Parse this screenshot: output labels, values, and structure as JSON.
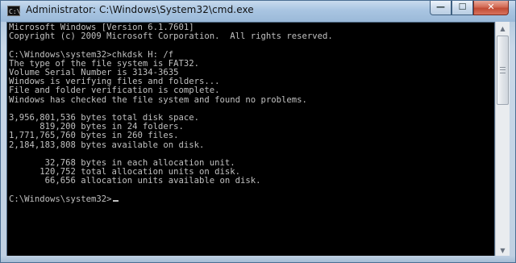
{
  "window": {
    "title": "Administrator: C:\\Windows\\System32\\cmd.exe",
    "icon_label": "C:\\",
    "controls": {
      "minimize": "—",
      "maximize": "☐",
      "close": "✕"
    }
  },
  "console": {
    "lines": [
      "Microsoft Windows [Version 6.1.7601]",
      "Copyright (c) 2009 Microsoft Corporation.  All rights reserved.",
      "",
      "C:\\Windows\\system32>chkdsk H: /f",
      "The type of the file system is FAT32.",
      "Volume Serial Number is 3134-3635",
      "Windows is verifying files and folders...",
      "File and folder verification is complete.",
      "Windows has checked the file system and found no problems.",
      "",
      "3,956,801,536 bytes total disk space.",
      "      819,200 bytes in 24 folders.",
      "1,771,765,760 bytes in 260 files.",
      "2,184,183,808 bytes available on disk.",
      "",
      "       32,768 bytes in each allocation unit.",
      "      120,752 total allocation units on disk.",
      "       66,656 allocation units available on disk.",
      "",
      "C:\\Windows\\system32>"
    ]
  },
  "scrollbar": {
    "up_arrow": "▲",
    "down_arrow": "▼"
  },
  "colors": {
    "console_bg": "#000000",
    "console_fg": "#c0c0c0",
    "close_button": "#c94b34"
  }
}
